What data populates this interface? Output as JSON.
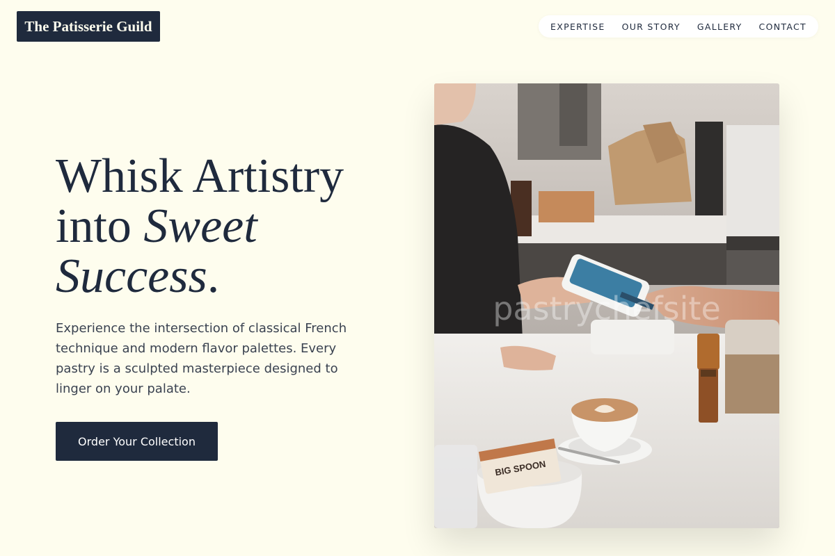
{
  "brand": {
    "logo_text": "The Patisserie Guild"
  },
  "nav": {
    "items": [
      {
        "label": "EXPERTISE"
      },
      {
        "label": "OUR STORY"
      },
      {
        "label": "GALLERY"
      },
      {
        "label": "CONTACT"
      }
    ]
  },
  "hero": {
    "headline_part1": "Whisk Artistry into ",
    "headline_italic": "Sweet Success",
    "headline_end": ".",
    "description": "Experience the intersection of classical French technique and modern flavor palettes. Every pastry is a sculpted masterpiece designed to linger on your palate.",
    "cta_label": "Order Your Collection",
    "image_watermark": "pastrychefsite",
    "bag_label": "BIG SPOON"
  },
  "colors": {
    "background": "#fefdee",
    "primary": "#1f2a3d",
    "text_muted": "#3a4250"
  }
}
